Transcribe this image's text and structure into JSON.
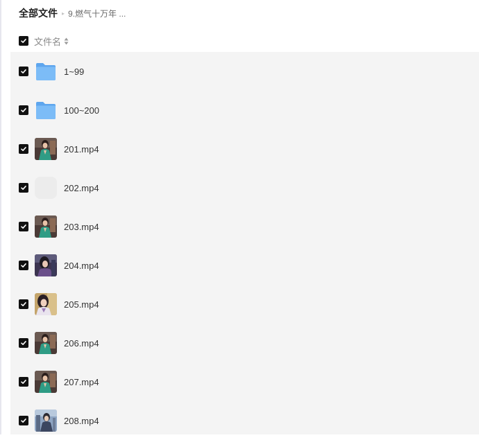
{
  "breadcrumb": {
    "root": "全部文件",
    "separator": "▸",
    "current": "9.燃气十万年 ..."
  },
  "header": {
    "column_label": "文件名",
    "sort_icon": "sort-icon",
    "select_all_checked": true
  },
  "colors": {
    "checkbox_fill": "#111111",
    "list_background": "#f4f4f4",
    "folder_blue": "#6fb3f5"
  },
  "files": [
    {
      "name": "1~99",
      "type": "folder",
      "icon": "folder-icon",
      "checked": true
    },
    {
      "name": "100~200",
      "type": "folder",
      "icon": "folder-icon",
      "checked": true
    },
    {
      "name": "201.mp4",
      "type": "video",
      "icon": "video-thumbnail",
      "checked": true
    },
    {
      "name": "202.mp4",
      "type": "video",
      "icon": "blank-thumbnail",
      "checked": true
    },
    {
      "name": "203.mp4",
      "type": "video",
      "icon": "video-thumbnail",
      "checked": true
    },
    {
      "name": "204.mp4",
      "type": "video",
      "icon": "video-thumbnail",
      "checked": true
    },
    {
      "name": "205.mp4",
      "type": "video",
      "icon": "video-thumbnail",
      "checked": true
    },
    {
      "name": "206.mp4",
      "type": "video",
      "icon": "video-thumbnail",
      "checked": true
    },
    {
      "name": "207.mp4",
      "type": "video",
      "icon": "video-thumbnail",
      "checked": true
    },
    {
      "name": "208.mp4",
      "type": "video",
      "icon": "video-thumbnail",
      "checked": true
    }
  ]
}
